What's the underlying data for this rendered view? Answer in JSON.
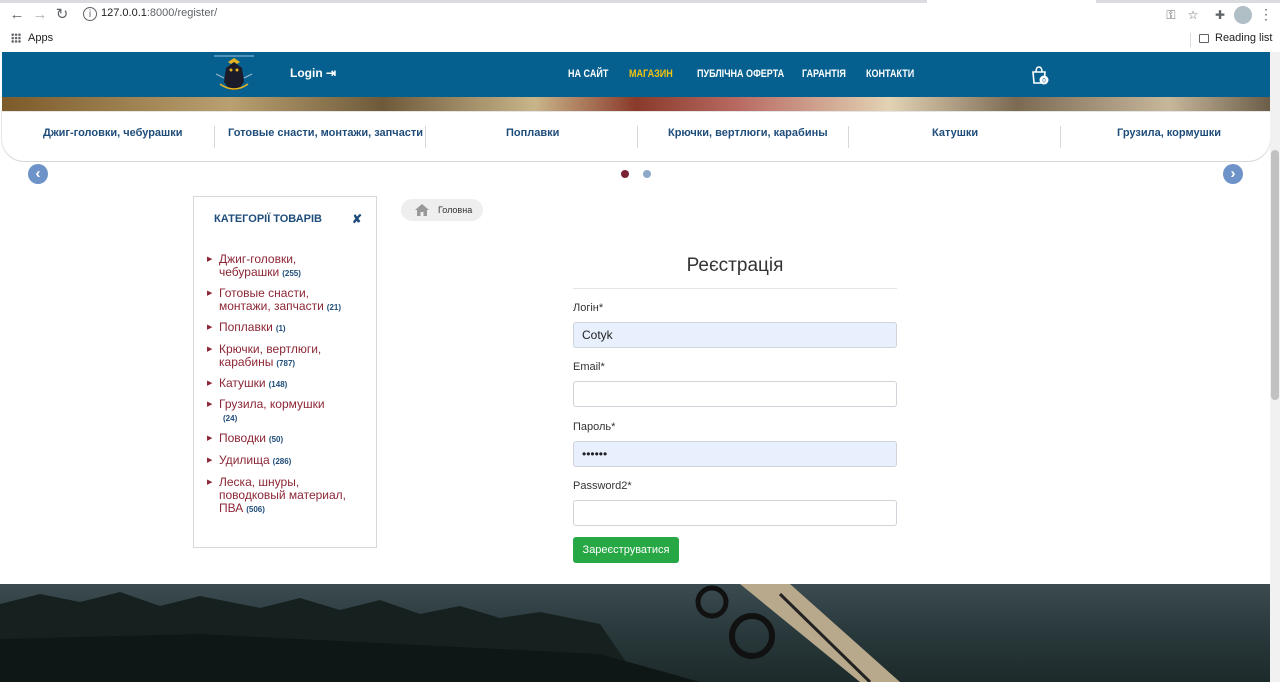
{
  "browser": {
    "url_host": "127.0.0.1",
    "url_rest": ":8000/register/",
    "bookmarks": {
      "apps": "Apps",
      "reading_list": "Reading list"
    }
  },
  "header": {
    "login": "Login",
    "nav": [
      "НА САЙТ",
      "МАГАЗИН",
      "ПУБЛІЧНА ОФЕРТА",
      "ГАРАНТІЯ",
      "КОНТАКТИ"
    ],
    "active_nav": "МАГАЗИН",
    "cart_count": "0",
    "colors": {
      "bar": "#05608f",
      "active": "#f1c40f"
    }
  },
  "category_bar": [
    "Джиг-головки, чебурашки",
    "Готовые снасти, монтажи, запчасти",
    "Поплавки",
    "Крючки, вертлюги, карабины",
    "Катушки",
    "Грузила, кормушки"
  ],
  "carousel": {
    "active_dot": 1,
    "dot_count": 2
  },
  "sidebar": {
    "title": "КАТЕГОРІЇ ТОВАРІВ",
    "close": "✘",
    "items": [
      {
        "label": "Джиг-головки, чебурашки",
        "count": "(255)"
      },
      {
        "label": "Готовые снасти, монтажи, запчасти",
        "count": "(21)"
      },
      {
        "label": "Поплавки",
        "count": "(1)"
      },
      {
        "label": "Крючки, вертлюги, карабины",
        "count": "(787)"
      },
      {
        "label": "Катушки",
        "count": "(148)"
      },
      {
        "label": "Грузила, кормушки",
        "count": "(24)"
      },
      {
        "label": "Поводки",
        "count": "(50)"
      },
      {
        "label": "Удилища",
        "count": "(286)"
      },
      {
        "label": "Леска, шнуры, поводковый материал, ПВА",
        "count": "(506)"
      }
    ]
  },
  "breadcrumb": {
    "home": "Головна"
  },
  "form": {
    "title": "Реєстрація",
    "login_label": "Логін*",
    "login_value": "Cotyk",
    "email_label": "Email*",
    "email_value": "",
    "password_label": "Пароль*",
    "password_value": "••••••",
    "password2_label": "Password2*",
    "password2_value": "",
    "submit": "Зареєструватися",
    "submit_color": "#28a745"
  }
}
